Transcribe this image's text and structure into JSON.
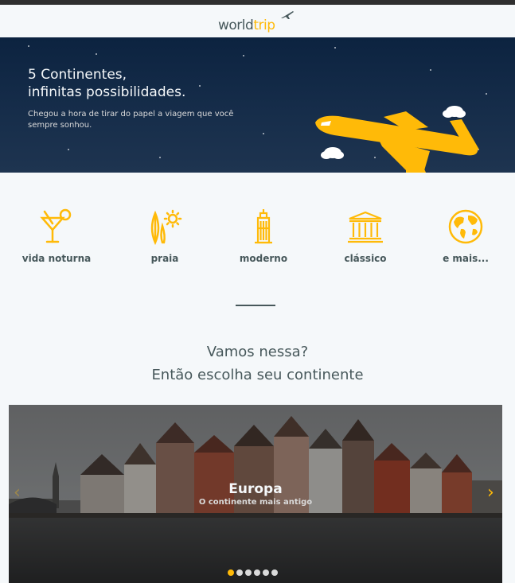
{
  "header": {
    "logo_world": "world",
    "logo_trip": "trip",
    "logo_icon": "airplane-icon"
  },
  "hero": {
    "title_line1": "5 Continentes,",
    "title_line2": "infinitas possibilidades.",
    "subtitle": "Chegou a hora de tirar do papel a viagem que você sempre sonhou."
  },
  "categories": [
    {
      "label": "vida noturna",
      "icon": "cocktail-icon"
    },
    {
      "label": "praia",
      "icon": "surfboard-sun-icon"
    },
    {
      "label": "moderno",
      "icon": "skyscraper-icon"
    },
    {
      "label": "clássico",
      "icon": "museum-icon"
    },
    {
      "label": "e mais...",
      "icon": "globe-icon"
    }
  ],
  "cta": {
    "line1": "Vamos nessa?",
    "line2": "Então escolha seu continente"
  },
  "slider": {
    "title": "Europa",
    "subtitle": "O continente mais antigo",
    "prev_icon": "chevron-left-icon",
    "next_icon": "chevron-right-icon",
    "slide_count": 6,
    "active_index": 0
  },
  "colors": {
    "accent": "#ffba08",
    "text": "#47585b",
    "background": "#f5f8fa",
    "hero": "#0c2340"
  }
}
